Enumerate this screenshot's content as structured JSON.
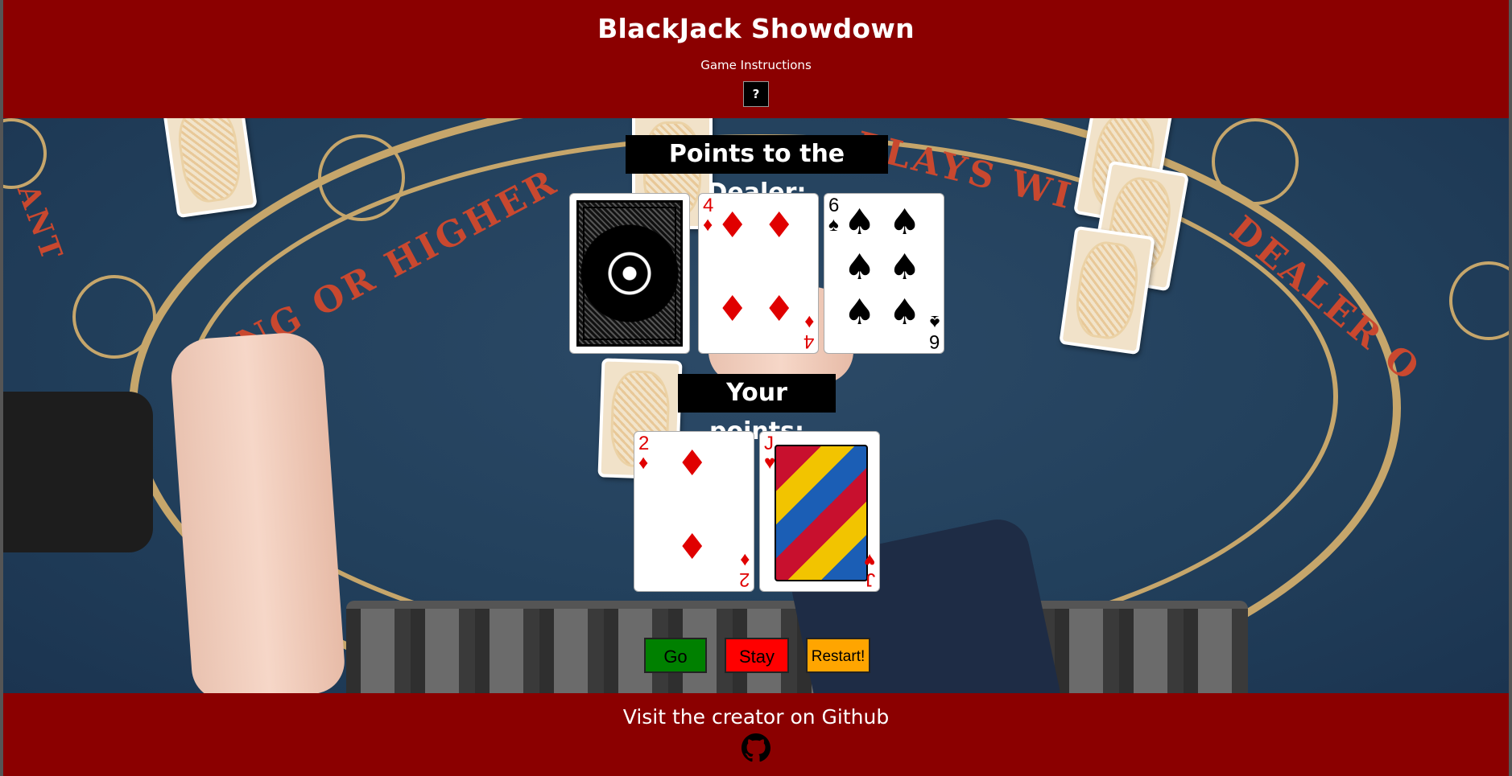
{
  "header": {
    "title": "BlackJack Showdown",
    "instructions_label": "Game Instructions",
    "help_button": "?"
  },
  "felt": {
    "arc_text_left": "KING OR HIGHER",
    "arc_text_right": "PLAYS WI",
    "arc_text_far_right": "DEALER O",
    "corner_text": "ANT"
  },
  "dealer": {
    "label": "Points to the Dealer:",
    "cards": [
      {
        "face": "back"
      },
      {
        "rank": "4",
        "suit": "♦",
        "color": "red"
      },
      {
        "rank": "6",
        "suit": "♠",
        "color": "black"
      }
    ]
  },
  "player": {
    "label": "Your points:",
    "cards": [
      {
        "rank": "2",
        "suit": "♦",
        "color": "red"
      },
      {
        "rank": "J",
        "suit": "♥",
        "color": "red"
      }
    ]
  },
  "controls": {
    "go": "Go",
    "stay": "Stay",
    "restart": "Restart!"
  },
  "footer": {
    "visit_text": "Visit the creator on Github",
    "icon": "github-icon"
  },
  "colors": {
    "banner": "#8b0000",
    "go": "#008000",
    "stay": "#ff0000",
    "restart": "#ffa500"
  }
}
